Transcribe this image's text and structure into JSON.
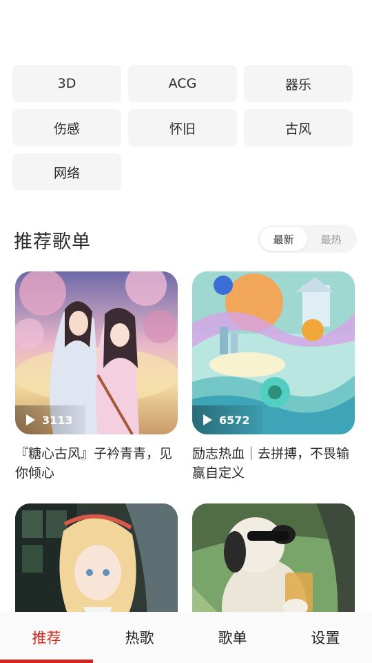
{
  "tags": [
    "3D",
    "ACG",
    "器乐",
    "伤感",
    "怀旧",
    "古风",
    "网络"
  ],
  "section": {
    "title": "推荐歌单",
    "sort_options": [
      "最新",
      "最热"
    ],
    "active_sort": "最新"
  },
  "playlists": [
    {
      "title": "『糖心古风』子衿青青，见你倾心",
      "play_count": "3113",
      "cover": "anime-couple-blossoms"
    },
    {
      "title": "励志热血｜去拼搏，不畏输赢自定义",
      "play_count": "6572",
      "cover": "mascots-colorful-landscape"
    },
    {
      "title": "",
      "play_count": "",
      "cover": "anime-blonde-girl"
    },
    {
      "title": "",
      "play_count": "",
      "cover": "plush-dog-sunglasses"
    }
  ],
  "nav": {
    "items": [
      "推荐",
      "热歌",
      "歌单",
      "设置"
    ],
    "active": "推荐"
  },
  "colors": {
    "accent": "#d3261b",
    "tag_bg": "#f5f5f5"
  }
}
